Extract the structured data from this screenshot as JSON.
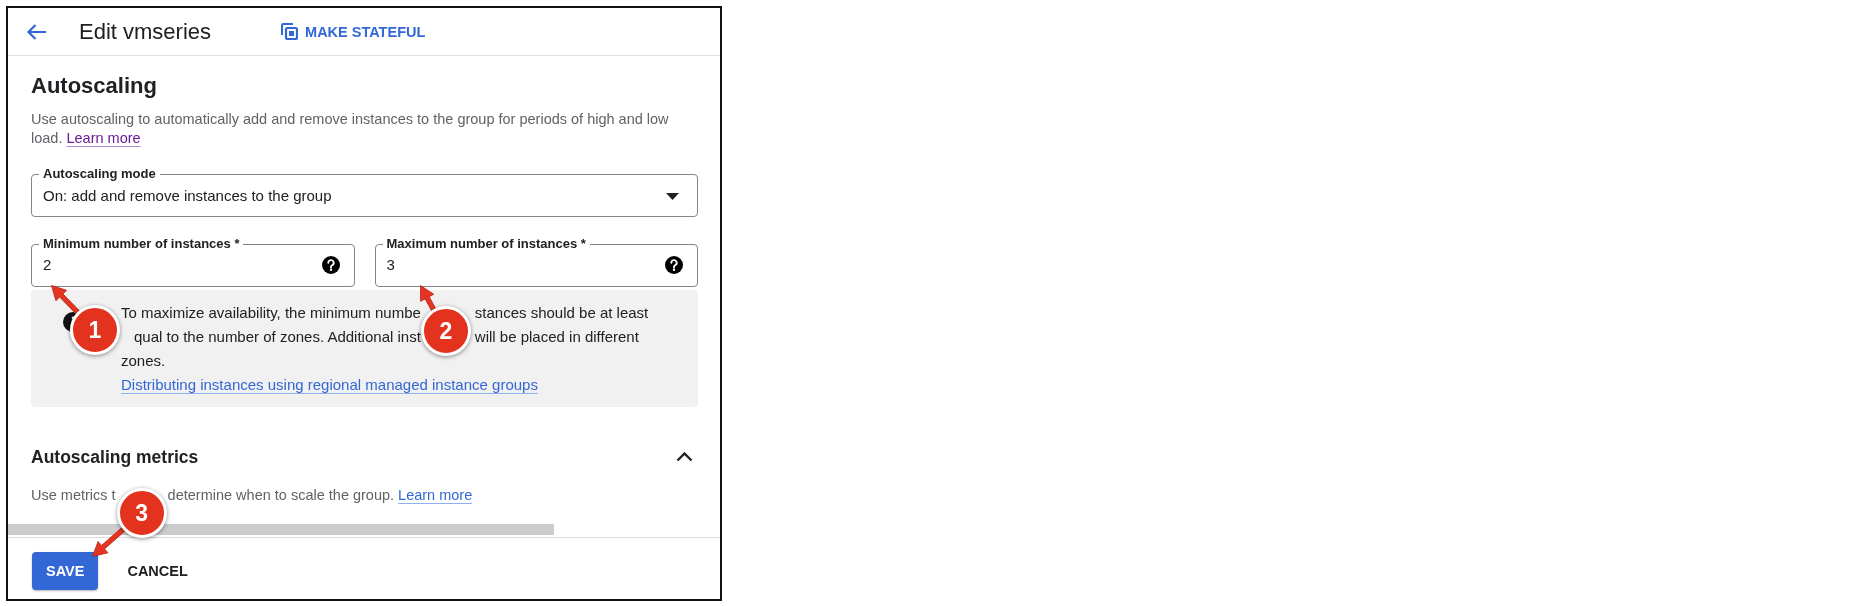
{
  "header": {
    "title": "Edit vmseries",
    "action": "MAKE STATEFUL"
  },
  "autoscaling": {
    "title": "Autoscaling",
    "description": "Use autoscaling to automatically add and remove instances to the group for periods of high and low load.",
    "description_link": {
      "label": "Learn more",
      "visited": true
    },
    "mode_select": {
      "label": "Autoscaling mode",
      "value": "On: add and remove instances to the group"
    },
    "fields": [
      {
        "label": "Minimum number of instances *",
        "value": "2"
      },
      {
        "label": "Maximum number of instances *",
        "value": "3"
      }
    ],
    "note": {
      "fragments": [
        "To maximize availability, the minimum numbe",
        "stances should be at least",
        "qual to the number of zones. Additional inst",
        "will be placed in different",
        "zones."
      ],
      "link": "Distributing instances using regional managed instance groups"
    }
  },
  "metrics": {
    "title": "Autoscaling metrics",
    "expanded": true,
    "description_fragments": [
      "Use metrics t",
      "determine when to scale the group."
    ],
    "link": {
      "label": "Learn more",
      "visited": false
    }
  },
  "footer": {
    "buttons": [
      {
        "label": "SAVE",
        "kind": "primary"
      },
      {
        "label": "CANCEL",
        "kind": "text"
      }
    ]
  },
  "callouts": [
    {
      "number": "1"
    },
    {
      "number": "2"
    },
    {
      "number": "3"
    }
  ]
}
